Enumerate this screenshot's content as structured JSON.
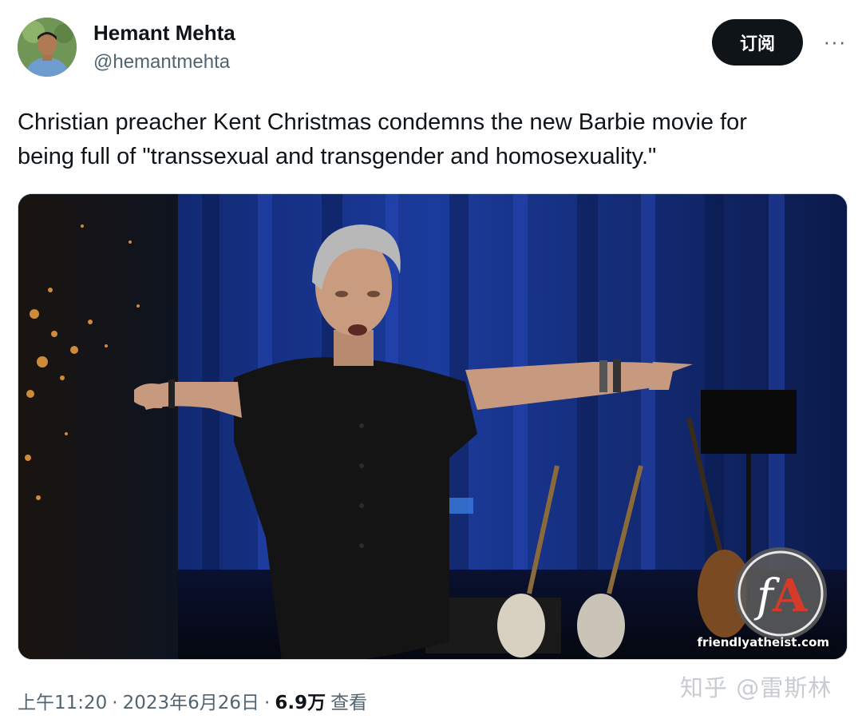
{
  "author": {
    "name": "Hemant Mehta",
    "handle": "@hemantmehta"
  },
  "actions": {
    "subscribe_label": "订阅",
    "more_label": "···"
  },
  "tweet": {
    "text_line1": "Christian preacher Kent Christmas condemns the new Barbie movie for",
    "text_line2": "being full of \"transsexual and transgender and homosexuality.\""
  },
  "media": {
    "watermark_site": "friendlyatheist.com",
    "watermark_logo": "fA"
  },
  "meta": {
    "time": "上午11:20",
    "sep1": "·",
    "date": "2023年6月26日",
    "sep2": "·",
    "views_count": "6.9万",
    "views_label": "查看"
  },
  "zhihu_watermark": "知乎 @雷斯林"
}
